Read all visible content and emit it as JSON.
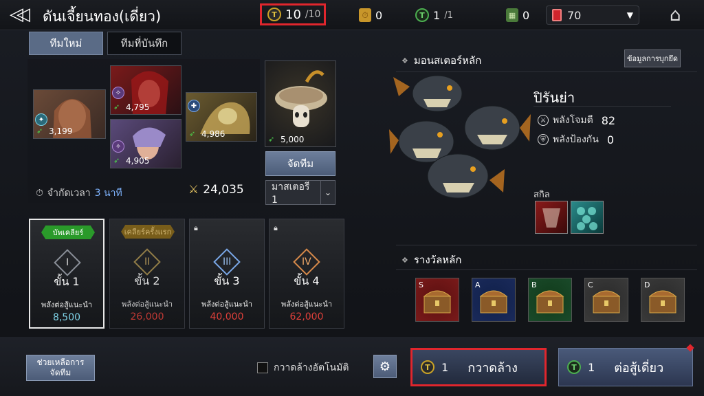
{
  "header": {
    "back_glyph": "◁◁",
    "title": "ดันเจี้ยนทอง(เดี่ยว)",
    "ticket_current": "10",
    "ticket_max": "/10",
    "coin_value": "0",
    "green_ticket_current": "1",
    "green_ticket_max": "/1",
    "card_value": "0",
    "ruby_value": "70",
    "dropdown_glyph": "▼",
    "home_glyph": "⌂"
  },
  "tabs": [
    {
      "label": "ทีมใหม่",
      "selected": true
    },
    {
      "label": "ทีมที่บันทึก",
      "selected": false
    }
  ],
  "team": {
    "heroes": [
      {
        "power": "3,199"
      },
      {
        "power": "4,795"
      },
      {
        "power": "4,905"
      },
      {
        "power": "4,986"
      }
    ],
    "master_power": "5,000",
    "arrange_label": "จัดทีม",
    "master_select": "มาสเตอรี 1",
    "time_limit_label": "จำกัดเวลา",
    "time_limit_value": "3 นาที",
    "total_power": "24,035"
  },
  "stages": [
    {
      "badge": "บัพเคลียร์",
      "roman": "I",
      "level": "ขั้น 1",
      "rec_label": "พลังต่อสู้แนะนำ",
      "rec_value": "8,500",
      "rec_color": "#7fd4e8",
      "locked": false,
      "selected": true
    },
    {
      "badge": "เคลียร์ครั้งแรก",
      "roman": "II",
      "level": "ขั้น 2",
      "rec_label": "พลังต่อสู้แนะนำ",
      "rec_value": "26,000",
      "rec_color": "#e0403a",
      "locked": false,
      "selected": false
    },
    {
      "badge": "",
      "roman": "III",
      "level": "ขั้น 3",
      "rec_label": "พลังต่อสู้แนะนำ",
      "rec_value": "40,000",
      "rec_color": "#e0403a",
      "locked": true,
      "selected": false
    },
    {
      "badge": "",
      "roman": "IV",
      "level": "ขั้น 4",
      "rec_label": "พลังต่อสู้แนะนำ",
      "rec_value": "62,000",
      "rec_color": "#e0403a",
      "locked": true,
      "selected": false
    }
  ],
  "boss": {
    "header": "มอนสเตอร์หลัก",
    "info_button": "ข้อมูลการบุกยึด",
    "name": "ปิรันย่า",
    "attack_label": "พลังโจมตี",
    "attack_value": "82",
    "defense_label": "พลังป้องกัน",
    "defense_value": "0",
    "skill_label": "สกิล"
  },
  "rewards": {
    "header": "รางวัลหลัก",
    "chests": [
      {
        "grade": "S",
        "color": "#7a1a1a"
      },
      {
        "grade": "A",
        "color": "#1a2a5a"
      },
      {
        "grade": "B",
        "color": "#1a4a2a"
      },
      {
        "grade": "C",
        "color": "#3a3a3a"
      },
      {
        "grade": "D",
        "color": "#3a3a3a"
      }
    ]
  },
  "footer": {
    "help_line1": "ช่วยเหลือการ",
    "help_line2": "จัดทีม",
    "auto_sweep_label": "กวาดล้างอัตโนมัติ",
    "sweep_cost": "1",
    "sweep_label": "กวาดล้าง",
    "fight_cost": "1",
    "fight_label": "ต่อสู้เดี่ยว"
  },
  "icons": {
    "ticket": "T"
  }
}
